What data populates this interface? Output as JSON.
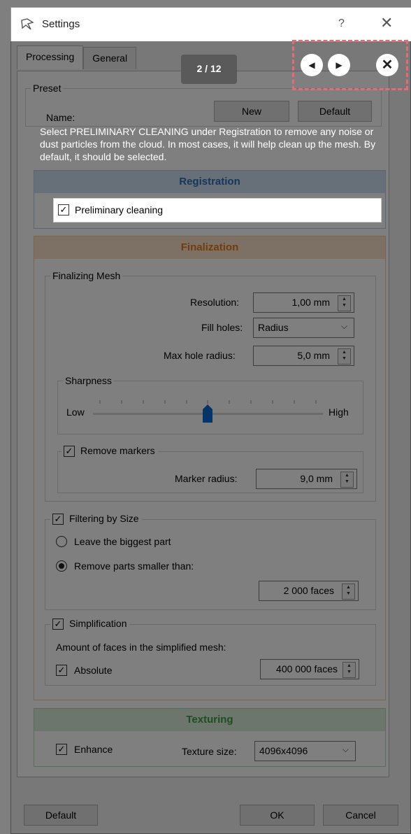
{
  "window": {
    "title": "Settings",
    "help": "?",
    "close": "✕"
  },
  "tabs": [
    {
      "label": "Processing"
    },
    {
      "label": "General"
    }
  ],
  "preset": {
    "label": "Preset",
    "name_label": "Name:",
    "new_label": "New",
    "default_label": "Default"
  },
  "registration": {
    "title": "Registration",
    "preliminary_cleaning": {
      "label": "Preliminary cleaning",
      "checked": true
    }
  },
  "finalization": {
    "title": "Finalization",
    "finalizing_mesh": {
      "label": "Finalizing Mesh",
      "resolution_label": "Resolution:",
      "resolution_value": "1,00 mm",
      "fill_holes_label": "Fill holes:",
      "fill_holes_value": "Radius",
      "max_hole_radius_label": "Max hole radius:",
      "max_hole_radius_value": "5,0 mm",
      "sharpness": {
        "label": "Sharpness",
        "low": "Low",
        "high": "High",
        "level": 0.5
      },
      "remove_markers": {
        "label": "Remove markers",
        "checked": true,
        "marker_radius_label": "Marker radius:",
        "marker_radius_value": "9,0 mm"
      }
    },
    "filtering": {
      "label": "Filtering by Size",
      "checked": true,
      "leave_biggest": "Leave the biggest part",
      "remove_smaller": "Remove parts smaller than:",
      "faces_value": "2 000 faces"
    },
    "simplification": {
      "label": "Simplification",
      "checked": true,
      "amount_label": "Amount of faces in the simplified mesh:",
      "absolute_label": "Absolute",
      "absolute_checked": true,
      "faces_value": "400 000 faces"
    }
  },
  "texturing": {
    "title": "Texturing",
    "enhance_label": "Enhance",
    "enhance_checked": true,
    "texture_size_label": "Texture size:",
    "texture_size_value": "4096x4096"
  },
  "footer": {
    "default_label": "Default",
    "ok_label": "OK",
    "cancel_label": "Cancel"
  },
  "tutorial": {
    "counter": "2 / 12",
    "text": "Select PRELIMINARY CLEANING under Registration to remove any noise or dust particles from the cloud. In most cases, it will help clean up the mesh. By default, it should be selected."
  },
  "icons": {
    "prev": "chevron-left-icon",
    "next": "chevron-right-icon",
    "close": "close-icon",
    "check": "✓"
  },
  "colors": {
    "registration": "#cfe0f1",
    "finalization": "#fbe3cc",
    "texturing": "#d9edd9",
    "highlight_border": "#e96a74",
    "overlay": "rgba(0,0,0,0.5)"
  }
}
